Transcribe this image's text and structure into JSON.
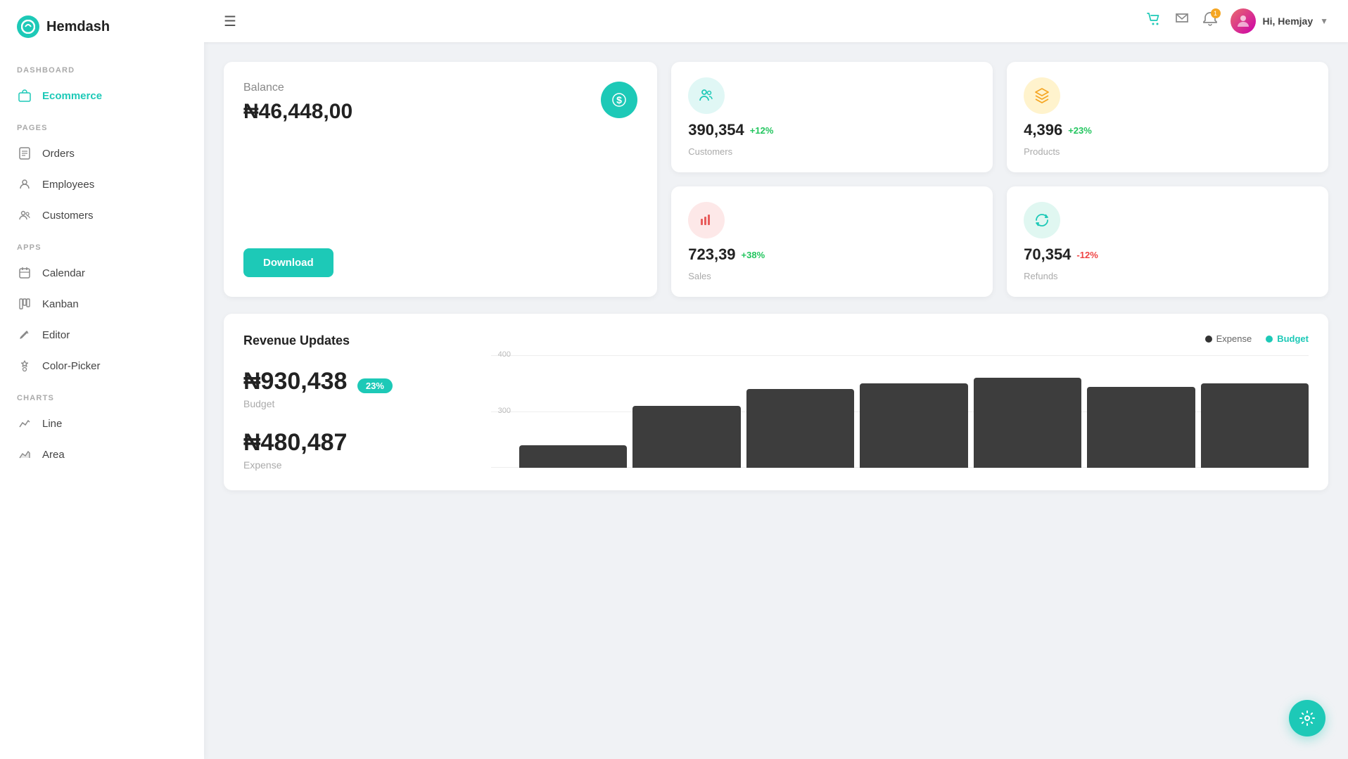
{
  "brand": {
    "name": "Hemdash",
    "logo_symbol": "●"
  },
  "sidebar": {
    "dashboard_label": "DASHBOARD",
    "pages_label": "PAGES",
    "apps_label": "APPS",
    "charts_label": "CHARTS",
    "items": {
      "ecommerce": "Ecommerce",
      "orders": "Orders",
      "employees": "Employees",
      "customers": "Customers",
      "calendar": "Calendar",
      "kanban": "Kanban",
      "editor": "Editor",
      "color_picker": "Color-Picker",
      "line": "Line",
      "area": "Area"
    }
  },
  "header": {
    "greeting": "Hi,",
    "username": "Hemjay",
    "notif_count": "1"
  },
  "balance": {
    "label": "Balance",
    "amount": "₦46,448,00",
    "download_btn": "Download"
  },
  "stats": {
    "customers": {
      "value": "390,354",
      "change": "+12%",
      "change_type": "positive",
      "label": "Customers"
    },
    "products": {
      "value": "4,396",
      "change": "+23%",
      "change_type": "positive",
      "label": "Products"
    },
    "sales": {
      "value": "723,39",
      "change": "+38%",
      "change_type": "positive",
      "label": "Sales"
    },
    "refunds": {
      "value": "70,354",
      "change": "-12%",
      "change_type": "negative",
      "label": "Refunds"
    }
  },
  "revenue": {
    "title": "Revenue Updates",
    "legend_expense": "Expense",
    "legend_budget": "Budget",
    "budget_amount": "₦930,438",
    "budget_badge": "23%",
    "budget_label": "Budget",
    "expense_amount": "₦480,487",
    "expense_label": "Expense"
  },
  "chart": {
    "y_labels": [
      "400",
      "300"
    ],
    "bars": [
      20,
      55,
      70,
      75,
      80,
      72,
      75
    ]
  }
}
